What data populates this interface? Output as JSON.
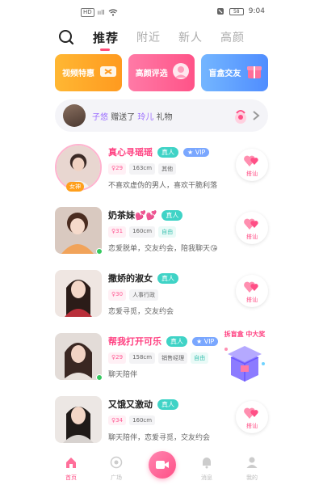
{
  "status_bar": {
    "hd": "HD",
    "signal": "ııll",
    "battery": "58",
    "time": "9:04"
  },
  "nav": {
    "tabs": [
      "推荐",
      "附近",
      "新人",
      "高颜"
    ],
    "active": 0
  },
  "features": [
    {
      "label": "视频特惠",
      "color": "#ffa726",
      "icon": "coupon-icon"
    },
    {
      "label": "高颜评选",
      "color": "#ff5e8e",
      "icon": "avatar-frame-icon"
    },
    {
      "label": "盲盒交友",
      "color": "#5b9bff",
      "icon": "gift-box-icon"
    }
  ],
  "gift_banner": {
    "sender": "子悠",
    "verb": "赠送了",
    "receiver": "玲儿",
    "suffix": "礼物"
  },
  "users": [
    {
      "name": "真心寻瑶瑶",
      "real": "真人",
      "vip": "VIP",
      "age": "29",
      "height": "163cm",
      "job": "其他",
      "bio": "不喜欢虚伪的男人，喜欢干脆利落",
      "badge": "女神",
      "chat": "搭讪"
    },
    {
      "name": "奶茶妹💕💕",
      "real": "真人",
      "age": "31",
      "height": "160cm",
      "job": "自由",
      "bio": "恋爱脱单，交友约会，陪我聊天😘",
      "chat": "搭讪"
    },
    {
      "name": "撒娇的淑女",
      "real": "真人",
      "age": "30",
      "job": "人事行政",
      "bio": "恋爱寻觅，交友约会",
      "chat": "搭讪"
    },
    {
      "name": "帮我打开可乐",
      "real": "真人",
      "vip": "VIP",
      "age": "29",
      "height": "158cm",
      "job": "销售经理",
      "job2": "自由",
      "bio": "聊天陪伴",
      "promo": "拆盲盒 中大奖"
    },
    {
      "name": "又饿又激动",
      "real": "真人",
      "age": "34",
      "height": "160cm",
      "bio": "聊天陪伴，恋爱寻觅，交友约会",
      "chat": "搭讪"
    }
  ],
  "bottom_nav": [
    "首页",
    "广场",
    "消息",
    "我的"
  ],
  "colors": {
    "accent": "#ff4f86",
    "mint": "#3fd3c6",
    "vip": "#7aa7ff"
  }
}
